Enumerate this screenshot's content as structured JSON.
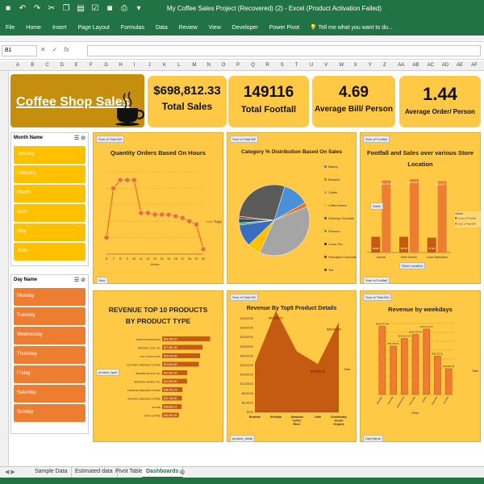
{
  "window": {
    "title": "My Coffee Sales Project (Recovered) (2) - Excel (Product Activation Failed)"
  },
  "ribbon": {
    "tabs": [
      "File",
      "Home",
      "Insert",
      "Page Layout",
      "Formulas",
      "Data",
      "Review",
      "View",
      "Developer",
      "Power Pivot"
    ],
    "tell_me": "Tell me what you want to do..."
  },
  "formula_bar": {
    "name_box": "B1",
    "value": ""
  },
  "columns": [
    "A",
    "B",
    "C",
    "D",
    "E",
    "F",
    "G",
    "H",
    "I",
    "J",
    "K",
    "L",
    "M",
    "N",
    "O",
    "P",
    "Q",
    "R",
    "S",
    "T",
    "U",
    "V",
    "W",
    "X",
    "Y",
    "Z",
    "AA",
    "AB",
    "AC",
    "AD",
    "AE",
    "AF"
  ],
  "dashboard": {
    "logo_text": "Coffee Shop Sales",
    "kpis": [
      {
        "value": "$698,812.33",
        "label": "Total Sales"
      },
      {
        "value": "149116",
        "label": "Total Footfall"
      },
      {
        "value": "4.69",
        "label": "Average Bill/ Person"
      },
      {
        "value": "1.44",
        "label": "Average Order/ Person"
      }
    ],
    "month_slicer": {
      "title": "Month Name",
      "items": [
        "January",
        "February",
        "March",
        "April",
        "May",
        "June"
      ]
    },
    "day_slicer": {
      "title": "Day Name",
      "items": [
        "Monday",
        "Tuesday",
        "Wednesday",
        "Thursday",
        "Friday",
        "Saturday",
        "Sunday"
      ]
    },
    "colors": {
      "excel_green": "#217346",
      "panel_gold": "#ffc845",
      "logo_brown": "#c58e0d",
      "orange": "#ed7d31",
      "dark_orange": "#c55a11",
      "month_yellow": "#ffc000"
    }
  },
  "chart_data": [
    {
      "type": "line",
      "title": "Quantity Orders Based On Hours",
      "field_button": "Sum of Total Bill",
      "axis_button": "Hour",
      "xlabel": "Hours",
      "ylabel": "",
      "legend": "Total",
      "x": [
        6,
        7,
        8,
        9,
        10,
        11,
        12,
        13,
        14,
        15,
        16,
        17,
        18,
        19,
        20
      ],
      "y": [
        10000,
        40000,
        45000,
        45000,
        45000,
        25000,
        25000,
        24000,
        24000,
        24000,
        23000,
        22000,
        20000,
        18000,
        3000
      ],
      "ylim": [
        0,
        50000
      ],
      "grid": true
    },
    {
      "type": "pie",
      "title": "Category % Distribution Based On Sales",
      "field_button": "Sum of Total Bill",
      "legend_placement": "right",
      "labels": [
        "Bakery",
        "Branded",
        "Coffee",
        "Coffee beans",
        "Drinking Chocolate",
        "Flavours",
        "Loose Tea",
        "Packaged Chocolate",
        "Tea"
      ],
      "values": [
        12,
        2,
        38,
        6,
        10,
        1,
        2,
        1,
        28
      ],
      "colors": [
        "#4a90d9",
        "#e8741c",
        "#a5a5a5",
        "#ffc000",
        "#3a6cc0",
        "#6aa84f",
        "#1f4e79",
        "#9e480e",
        "#5a5a5a"
      ]
    },
    {
      "type": "bar",
      "title": "Footfall and Sales over various Store Location",
      "field_button": "Sum of Footfall",
      "axis_button": "Store Location",
      "slicer_button": "Sales",
      "legend_title": "Values",
      "legend_placement": "right",
      "categories": [
        "Astoria",
        "Hell's Kitchen",
        "Lower Manhattan"
      ],
      "series": [
        {
          "name": "Count of Footfall",
          "values": [
            50599,
            50735,
            47782
          ],
          "labels": [
            "50599",
            "50735",
            "47782"
          ]
        },
        {
          "name": "Sum of Total Bill",
          "values": [
            232243.91,
            236511.17,
            230057.25
          ],
          "labels": [
            "$232,243.91",
            "$236,511.17",
            "$230,057.25"
          ]
        }
      ]
    },
    {
      "type": "bar",
      "orientation": "horizontal",
      "title": "REVENUE TOP 10 PRODUCTS BY PRODUCT TYPE",
      "field_button": "Sum of Total Bill",
      "axis_button": "product_type",
      "categories": [
        "Barista Espresso",
        "Brewed Chai tea",
        "Hot chocolate",
        "Gourmet brewed coffee",
        "Brewed Black tea",
        "Brewed herbal tea",
        "Premium brewed coffee",
        "Organic brewed coffee",
        "Scone",
        "Drip coffee"
      ],
      "values": [
        91406.2,
        77081.95,
        72416,
        70034.6,
        47932,
        47539.5,
        38781.15,
        37746.5,
        36866.12,
        31984
      ],
      "value_labels": [
        "$91,406.20",
        "$77,081.95",
        "$72,416.00",
        "$70,034.60",
        "$47,932.00",
        "$47,539.50",
        "$38,781.15",
        "$37,746.50",
        "$36,866.12",
        "$31,984.00"
      ]
    },
    {
      "type": "area",
      "title": "Revenue By Top5 Product Details",
      "field_button": "Sum of Total Bill",
      "axis_button": "product_detail",
      "legend": "Total",
      "categories": [
        "Brazilian",
        "Ethiopia",
        "Jamaican Coffee River",
        "Latte",
        "Sustainably Grown Organic"
      ],
      "values": [
        21000,
        43300,
        26000,
        20600,
        38500
      ],
      "value_labels": [
        "",
        "$43,394.10",
        "",
        "$20,662.25",
        "$38,500.00"
      ],
      "ylim": [
        0,
        40000
      ],
      "yticks": [
        "$0.00",
        "$4,000.00",
        "$8,000.00",
        "$12,000.00",
        "$16,000.00",
        "$20,000.00",
        "$24,000.00",
        "$28,000.00",
        "$32,000.00",
        "$36,000.00",
        "$40,000.00"
      ]
    },
    {
      "type": "bar",
      "title": "Revenue by weekdays",
      "field_button": "Sum of Total Bill",
      "axis_button": "Day Name",
      "legend": "Total",
      "xlabel": "Days",
      "categories": [
        "Monday",
        "Tuesday",
        "Wednesday",
        "Thursday",
        "Friday",
        "Saturday",
        "Sunday"
      ],
      "values": [
        101677.28,
        99455.94,
        100313.54,
        100767.78,
        101373,
        98330.31,
        96894.48
      ],
      "value_labels": [
        "$101,677.28",
        "$99,455.94",
        "$100,313.54",
        "$100,767.78",
        "$101,373.00",
        "$98,330.31",
        "$96,894.48"
      ],
      "grid": true
    }
  ],
  "sheet_tabs": [
    "Sample Data",
    "Estimated data",
    "Pivot Table",
    "Dashboards"
  ],
  "active_tab": "Dashboards"
}
